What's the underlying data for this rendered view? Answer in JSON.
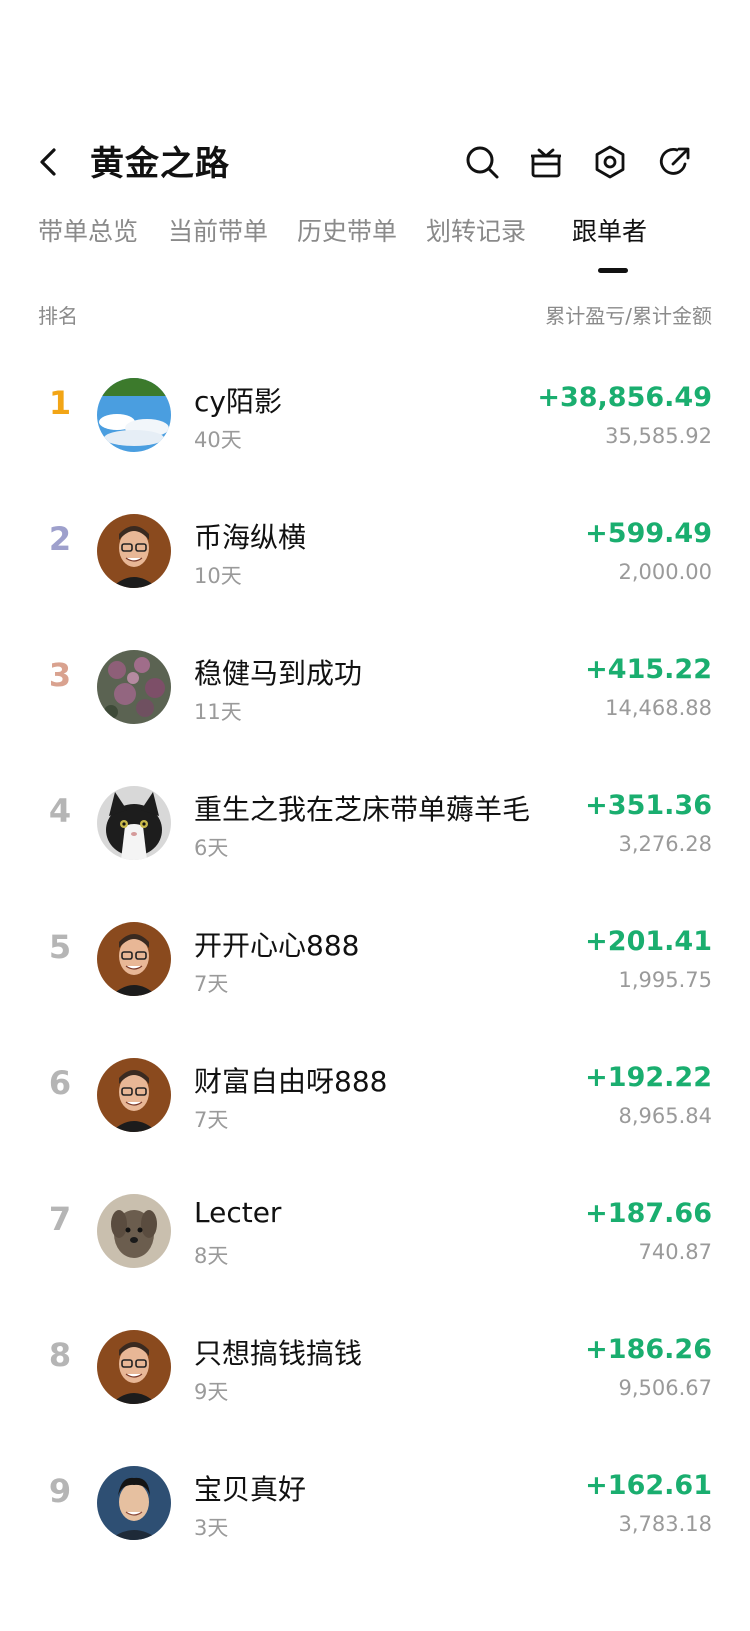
{
  "header": {
    "title": "黄金之路"
  },
  "tabs": [
    {
      "label": "带单总览"
    },
    {
      "label": "当前带单"
    },
    {
      "label": "历史带单"
    },
    {
      "label": "划转记录"
    },
    {
      "label": "跟单者",
      "active": true
    }
  ],
  "list_header": {
    "rank_label": "排名",
    "metric_label": "累计盈亏/累计金额"
  },
  "followers": [
    {
      "rank": "1",
      "name": "cy陌影",
      "days": "40天",
      "pnl": "+38,856.49",
      "amount": "35,585.92",
      "avatar": "sky"
    },
    {
      "rank": "2",
      "name": "币海纵横",
      "days": "10天",
      "pnl": "+599.49",
      "amount": "2,000.00",
      "avatar": "man"
    },
    {
      "rank": "3",
      "name": "稳健马到成功",
      "days": "11天",
      "pnl": "+415.22",
      "amount": "14,468.88",
      "avatar": "flowers"
    },
    {
      "rank": "4",
      "name": "重生之我在芝床带单薅羊毛",
      "days": "6天",
      "pnl": "+351.36",
      "amount": "3,276.28",
      "avatar": "cat"
    },
    {
      "rank": "5",
      "name": "开开心心888",
      "days": "7天",
      "pnl": "+201.41",
      "amount": "1,995.75",
      "avatar": "man"
    },
    {
      "rank": "6",
      "name": "财富自由呀888",
      "days": "7天",
      "pnl": "+192.22",
      "amount": "8,965.84",
      "avatar": "man"
    },
    {
      "rank": "7",
      "name": "Lecter",
      "days": "8天",
      "pnl": "+187.66",
      "amount": "740.87",
      "avatar": "dog"
    },
    {
      "rank": "8",
      "name": "只想搞钱搞钱",
      "days": "9天",
      "pnl": "+186.26",
      "amount": "9,506.67",
      "avatar": "man"
    },
    {
      "rank": "9",
      "name": "宝贝真好",
      "days": "3天",
      "pnl": "+162.61",
      "amount": "3,783.18",
      "avatar": "asian-man"
    }
  ],
  "colors": {
    "profit": "#1aae6f",
    "rank1": "#f2a516",
    "rank2": "#9ea0cc",
    "rank3": "#d9a28f",
    "muted": "#9a9a9a"
  }
}
